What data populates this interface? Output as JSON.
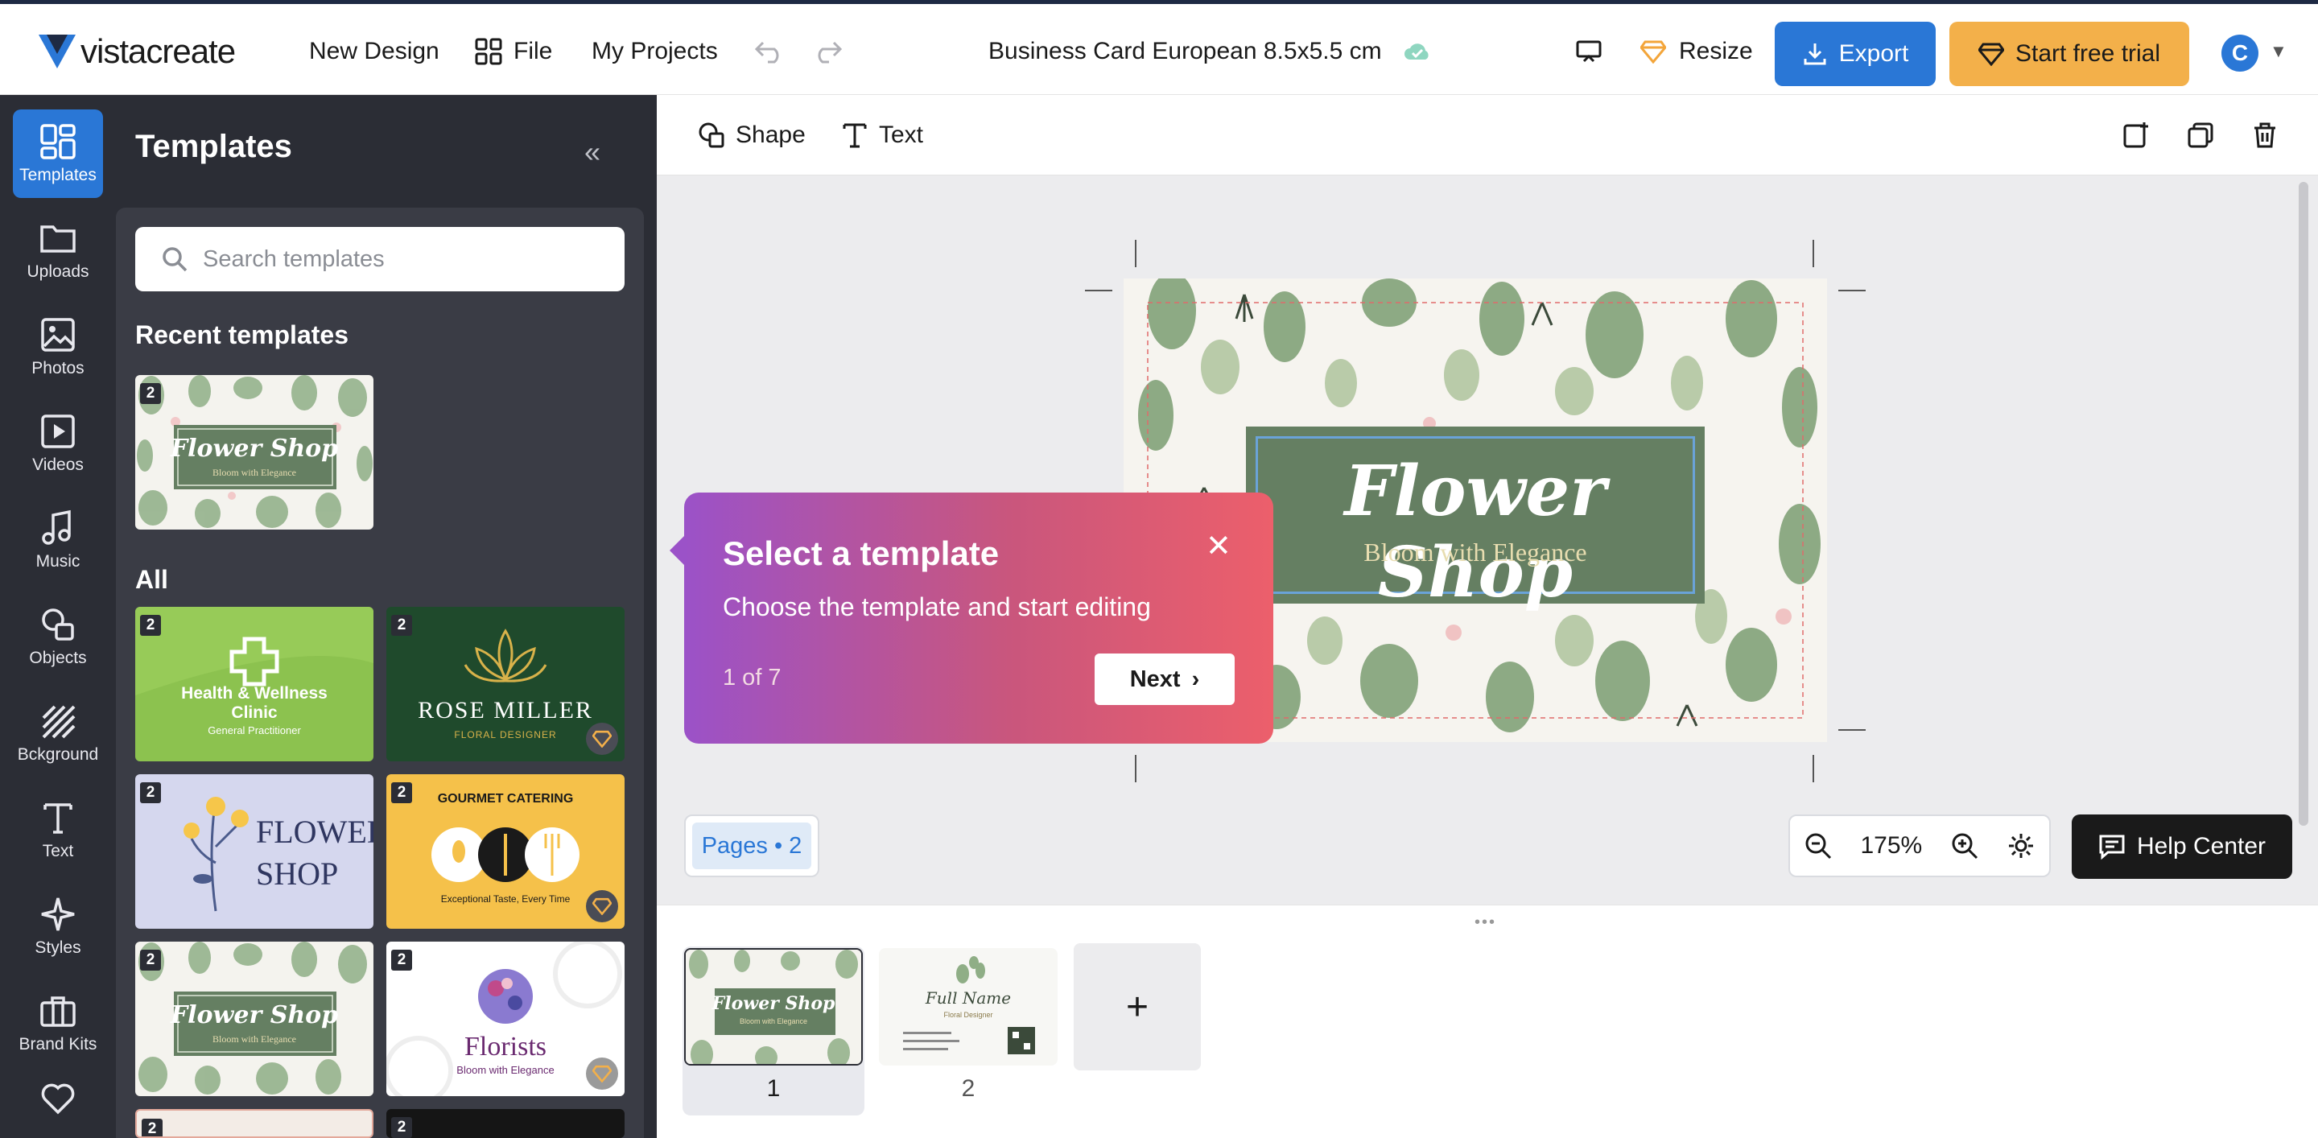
{
  "header": {
    "logo_text": "vistacreate",
    "new_design": "New Design",
    "file": "File",
    "my_projects": "My Projects",
    "doc_title": "Business Card European 8.5x5.5 cm",
    "resize": "Resize",
    "export": "Export",
    "trial": "Start free trial",
    "avatar_letter": "C"
  },
  "rail": {
    "items": [
      {
        "label": "Templates",
        "icon": "grid-icon"
      },
      {
        "label": "Uploads",
        "icon": "folder-icon"
      },
      {
        "label": "Photos",
        "icon": "image-icon"
      },
      {
        "label": "Videos",
        "icon": "video-icon"
      },
      {
        "label": "Music",
        "icon": "music-icon"
      },
      {
        "label": "Objects",
        "icon": "shapes-icon"
      },
      {
        "label": "Bckground",
        "icon": "pattern-icon"
      },
      {
        "label": "Text",
        "icon": "text-icon"
      },
      {
        "label": "Styles",
        "icon": "sparkle-icon"
      },
      {
        "label": "Brand Kits",
        "icon": "briefcase-icon"
      }
    ]
  },
  "panel": {
    "title": "Templates",
    "search_placeholder": "Search templates",
    "recent_heading": "Recent templates",
    "all_heading": "All",
    "recent": {
      "title": "Flower Shop",
      "sub": "Bloom with Elegance",
      "pages": "2"
    },
    "templates": [
      {
        "title": "Health & Wellness Clinic",
        "sub": "General Practitioner",
        "pages": "2",
        "premium": false
      },
      {
        "title": "ROSE MILLER",
        "sub": "FLORAL DESIGNER",
        "pages": "2",
        "premium": true
      },
      {
        "title": "FLOWER SHOP",
        "sub": "",
        "pages": "2",
        "premium": false
      },
      {
        "title": "GOURMET CATERING",
        "sub": "Exceptional Taste, Every Time",
        "pages": "2",
        "premium": true
      },
      {
        "title": "Flower Shop",
        "sub": "Bloom with Elegance",
        "pages": "2",
        "premium": false
      },
      {
        "title": "Florists",
        "sub": "Bloom with Elegance",
        "pages": "2",
        "premium": true
      }
    ],
    "partial_badges": [
      "2",
      "2"
    ]
  },
  "toolbar": {
    "shape": "Shape",
    "text": "Text"
  },
  "canvas": {
    "title": "Flower Shop",
    "subtitle": "Bloom with Elegance"
  },
  "tooltip": {
    "title": "Select a template",
    "body": "Choose the template and start editing",
    "step": "1 of 7",
    "next": "Next"
  },
  "controls": {
    "pages": "Pages • 2",
    "zoom": "175%",
    "help": "Help Center"
  },
  "strip": {
    "pages": [
      {
        "num": "1",
        "title": "Flower Shop",
        "sub": "Bloom with Elegance"
      },
      {
        "num": "2",
        "title": "Full Name",
        "sub": "Floral Designer"
      }
    ],
    "add": "+"
  },
  "colors": {
    "accent": "#2a77d6",
    "trial": "#f3b04a",
    "card_box": "#657f62"
  }
}
